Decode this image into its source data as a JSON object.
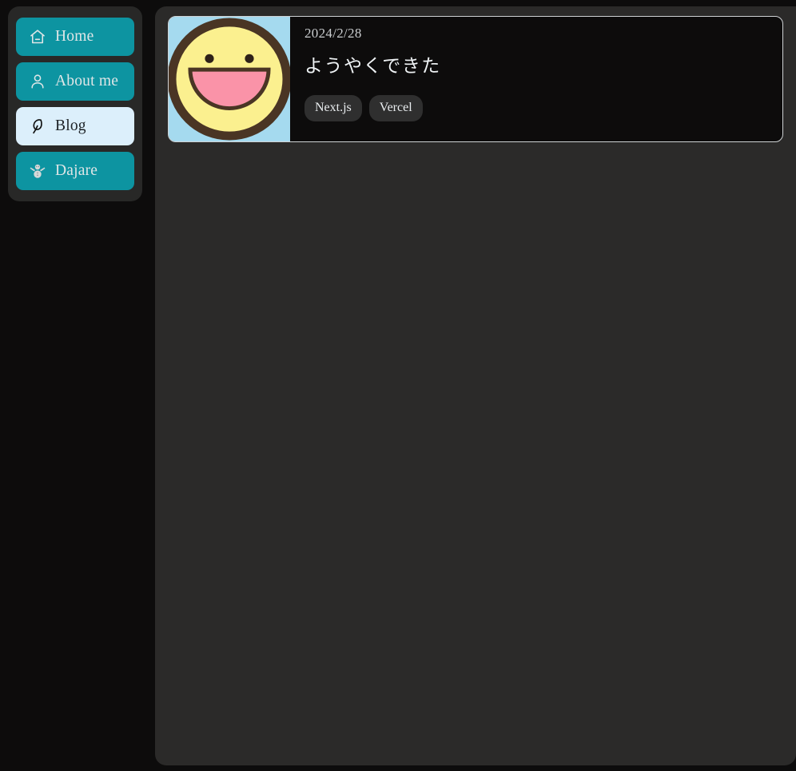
{
  "theme": {
    "page_background": "#0d0c0c",
    "sidebar_background": "#282827",
    "main_background": "#2b2a29",
    "accent_teal": "#0d94a1",
    "active_item_background": "#dceffb",
    "card_background": "#0d0c0c",
    "card_border": "#cfd2d4",
    "tag_background": "#2f2f2f",
    "text_light": "#dfe6e7",
    "text_dark": "#1d2226"
  },
  "sidebar": {
    "items": [
      {
        "label": "Home",
        "icon": "home-icon",
        "active": false
      },
      {
        "label": "About me",
        "icon": "person-icon",
        "active": false
      },
      {
        "label": "Blog",
        "icon": "feather-icon",
        "active": true
      },
      {
        "label": "Dajare",
        "icon": "snowman-icon",
        "active": false
      }
    ]
  },
  "main": {
    "posts": [
      {
        "date": "2024/2/28",
        "title": "ようやくできた",
        "thumbnail": "smiley-face-thumbnail",
        "thumbnail_colors": {
          "background": "#a5daef",
          "face": "#fbf08f",
          "outline": "#4a3524",
          "mouth": "#fa93a8"
        },
        "tags": [
          "Next.js",
          "Vercel"
        ]
      }
    ]
  }
}
